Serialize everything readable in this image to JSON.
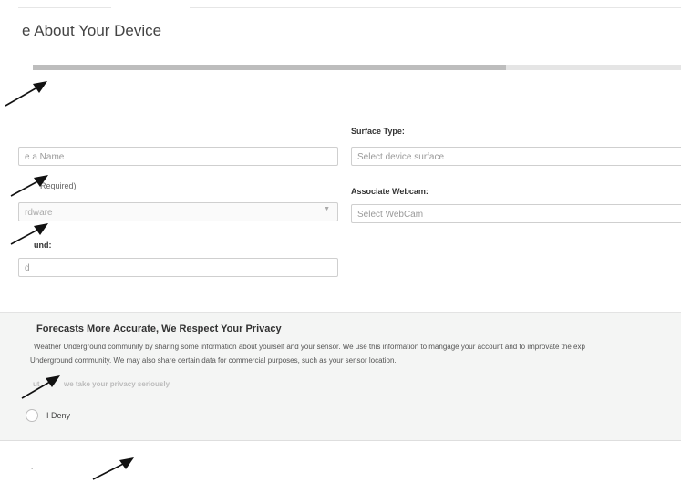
{
  "header": {
    "title": "e About Your Device"
  },
  "progress": {
    "fraction": 0.73
  },
  "form": {
    "name_placeholder": "e a Name",
    "hardware_label": "Required)",
    "hardware_value": "rdware",
    "ground_label": "und:",
    "ground_placeholder": "d",
    "surface_label": "Surface Type:",
    "surface_placeholder": "Select device surface",
    "webcam_label": "Associate Webcam:",
    "webcam_placeholder": "Select WebCam"
  },
  "privacy": {
    "title": "Forecasts More Accurate, We Respect Your Privacy",
    "line1": "Weather Underground community by sharing some information about yourself and your sensor. We use this information to mangage your account and to improvate the exp",
    "line2": "Underground community. We may also share certain data for commercial purposes, such as your sensor location.",
    "link_prefix": "ut",
    "link_text": "we take your privacy seriously",
    "deny_label": "I Deny"
  },
  "footer": {
    "partial_text": "."
  },
  "icons": {
    "arrow": "arrow-pointer-icon",
    "radio": "radio-icon",
    "caret": "chevron-down-icon"
  },
  "colors": {
    "progress_fill": "#bdbdbd",
    "progress_track": "#e5e5e5",
    "privacy_bg": "#f4f5f4",
    "arrow": "#111111"
  }
}
